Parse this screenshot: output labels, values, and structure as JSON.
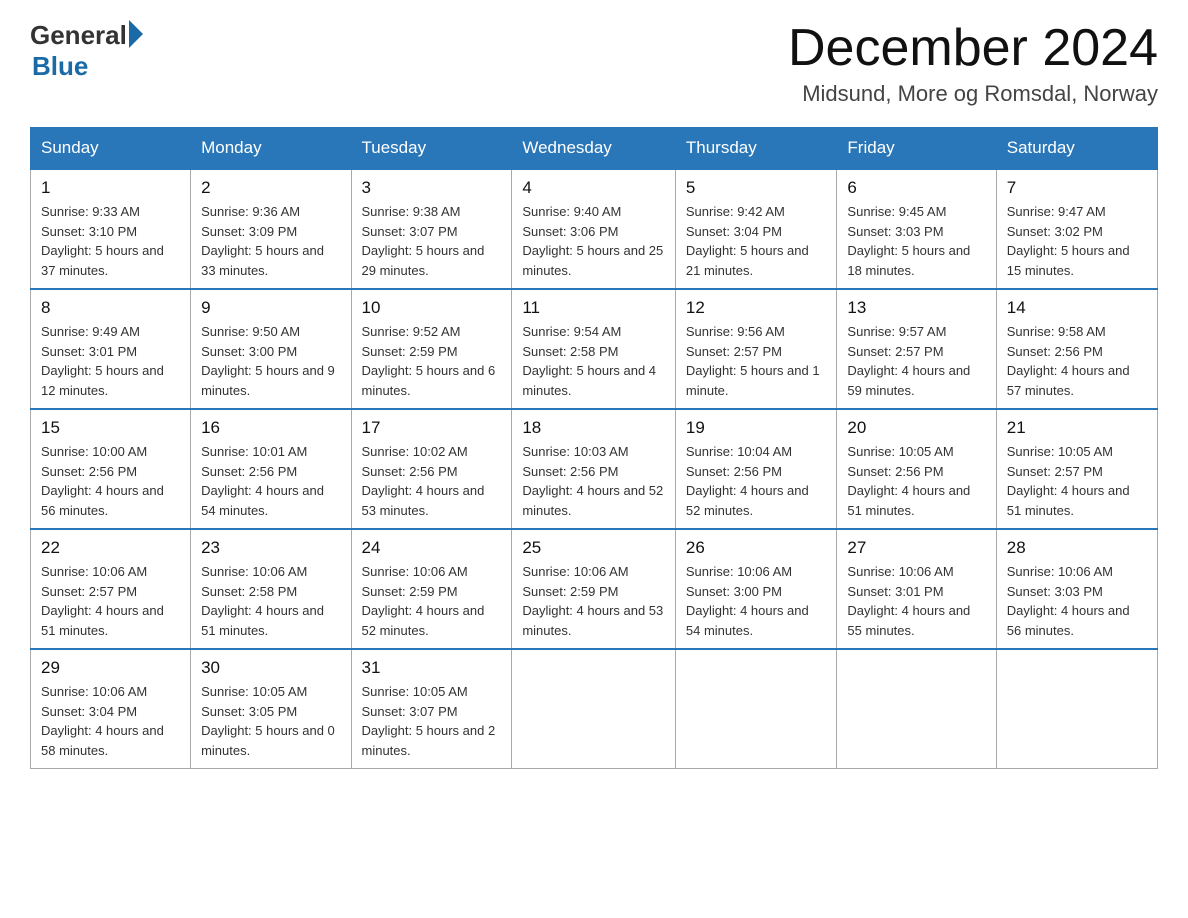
{
  "header": {
    "logo_general": "General",
    "logo_blue": "Blue",
    "month_title": "December 2024",
    "location": "Midsund, More og Romsdal, Norway"
  },
  "days_of_week": [
    "Sunday",
    "Monday",
    "Tuesday",
    "Wednesday",
    "Thursday",
    "Friday",
    "Saturday"
  ],
  "weeks": [
    [
      {
        "day": "1",
        "sunrise": "Sunrise: 9:33 AM",
        "sunset": "Sunset: 3:10 PM",
        "daylight": "Daylight: 5 hours and 37 minutes."
      },
      {
        "day": "2",
        "sunrise": "Sunrise: 9:36 AM",
        "sunset": "Sunset: 3:09 PM",
        "daylight": "Daylight: 5 hours and 33 minutes."
      },
      {
        "day": "3",
        "sunrise": "Sunrise: 9:38 AM",
        "sunset": "Sunset: 3:07 PM",
        "daylight": "Daylight: 5 hours and 29 minutes."
      },
      {
        "day": "4",
        "sunrise": "Sunrise: 9:40 AM",
        "sunset": "Sunset: 3:06 PM",
        "daylight": "Daylight: 5 hours and 25 minutes."
      },
      {
        "day": "5",
        "sunrise": "Sunrise: 9:42 AM",
        "sunset": "Sunset: 3:04 PM",
        "daylight": "Daylight: 5 hours and 21 minutes."
      },
      {
        "day": "6",
        "sunrise": "Sunrise: 9:45 AM",
        "sunset": "Sunset: 3:03 PM",
        "daylight": "Daylight: 5 hours and 18 minutes."
      },
      {
        "day": "7",
        "sunrise": "Sunrise: 9:47 AM",
        "sunset": "Sunset: 3:02 PM",
        "daylight": "Daylight: 5 hours and 15 minutes."
      }
    ],
    [
      {
        "day": "8",
        "sunrise": "Sunrise: 9:49 AM",
        "sunset": "Sunset: 3:01 PM",
        "daylight": "Daylight: 5 hours and 12 minutes."
      },
      {
        "day": "9",
        "sunrise": "Sunrise: 9:50 AM",
        "sunset": "Sunset: 3:00 PM",
        "daylight": "Daylight: 5 hours and 9 minutes."
      },
      {
        "day": "10",
        "sunrise": "Sunrise: 9:52 AM",
        "sunset": "Sunset: 2:59 PM",
        "daylight": "Daylight: 5 hours and 6 minutes."
      },
      {
        "day": "11",
        "sunrise": "Sunrise: 9:54 AM",
        "sunset": "Sunset: 2:58 PM",
        "daylight": "Daylight: 5 hours and 4 minutes."
      },
      {
        "day": "12",
        "sunrise": "Sunrise: 9:56 AM",
        "sunset": "Sunset: 2:57 PM",
        "daylight": "Daylight: 5 hours and 1 minute."
      },
      {
        "day": "13",
        "sunrise": "Sunrise: 9:57 AM",
        "sunset": "Sunset: 2:57 PM",
        "daylight": "Daylight: 4 hours and 59 minutes."
      },
      {
        "day": "14",
        "sunrise": "Sunrise: 9:58 AM",
        "sunset": "Sunset: 2:56 PM",
        "daylight": "Daylight: 4 hours and 57 minutes."
      }
    ],
    [
      {
        "day": "15",
        "sunrise": "Sunrise: 10:00 AM",
        "sunset": "Sunset: 2:56 PM",
        "daylight": "Daylight: 4 hours and 56 minutes."
      },
      {
        "day": "16",
        "sunrise": "Sunrise: 10:01 AM",
        "sunset": "Sunset: 2:56 PM",
        "daylight": "Daylight: 4 hours and 54 minutes."
      },
      {
        "day": "17",
        "sunrise": "Sunrise: 10:02 AM",
        "sunset": "Sunset: 2:56 PM",
        "daylight": "Daylight: 4 hours and 53 minutes."
      },
      {
        "day": "18",
        "sunrise": "Sunrise: 10:03 AM",
        "sunset": "Sunset: 2:56 PM",
        "daylight": "Daylight: 4 hours and 52 minutes."
      },
      {
        "day": "19",
        "sunrise": "Sunrise: 10:04 AM",
        "sunset": "Sunset: 2:56 PM",
        "daylight": "Daylight: 4 hours and 52 minutes."
      },
      {
        "day": "20",
        "sunrise": "Sunrise: 10:05 AM",
        "sunset": "Sunset: 2:56 PM",
        "daylight": "Daylight: 4 hours and 51 minutes."
      },
      {
        "day": "21",
        "sunrise": "Sunrise: 10:05 AM",
        "sunset": "Sunset: 2:57 PM",
        "daylight": "Daylight: 4 hours and 51 minutes."
      }
    ],
    [
      {
        "day": "22",
        "sunrise": "Sunrise: 10:06 AM",
        "sunset": "Sunset: 2:57 PM",
        "daylight": "Daylight: 4 hours and 51 minutes."
      },
      {
        "day": "23",
        "sunrise": "Sunrise: 10:06 AM",
        "sunset": "Sunset: 2:58 PM",
        "daylight": "Daylight: 4 hours and 51 minutes."
      },
      {
        "day": "24",
        "sunrise": "Sunrise: 10:06 AM",
        "sunset": "Sunset: 2:59 PM",
        "daylight": "Daylight: 4 hours and 52 minutes."
      },
      {
        "day": "25",
        "sunrise": "Sunrise: 10:06 AM",
        "sunset": "Sunset: 2:59 PM",
        "daylight": "Daylight: 4 hours and 53 minutes."
      },
      {
        "day": "26",
        "sunrise": "Sunrise: 10:06 AM",
        "sunset": "Sunset: 3:00 PM",
        "daylight": "Daylight: 4 hours and 54 minutes."
      },
      {
        "day": "27",
        "sunrise": "Sunrise: 10:06 AM",
        "sunset": "Sunset: 3:01 PM",
        "daylight": "Daylight: 4 hours and 55 minutes."
      },
      {
        "day": "28",
        "sunrise": "Sunrise: 10:06 AM",
        "sunset": "Sunset: 3:03 PM",
        "daylight": "Daylight: 4 hours and 56 minutes."
      }
    ],
    [
      {
        "day": "29",
        "sunrise": "Sunrise: 10:06 AM",
        "sunset": "Sunset: 3:04 PM",
        "daylight": "Daylight: 4 hours and 58 minutes."
      },
      {
        "day": "30",
        "sunrise": "Sunrise: 10:05 AM",
        "sunset": "Sunset: 3:05 PM",
        "daylight": "Daylight: 5 hours and 0 minutes."
      },
      {
        "day": "31",
        "sunrise": "Sunrise: 10:05 AM",
        "sunset": "Sunset: 3:07 PM",
        "daylight": "Daylight: 5 hours and 2 minutes."
      },
      null,
      null,
      null,
      null
    ]
  ],
  "accent_color": "#2976b8"
}
